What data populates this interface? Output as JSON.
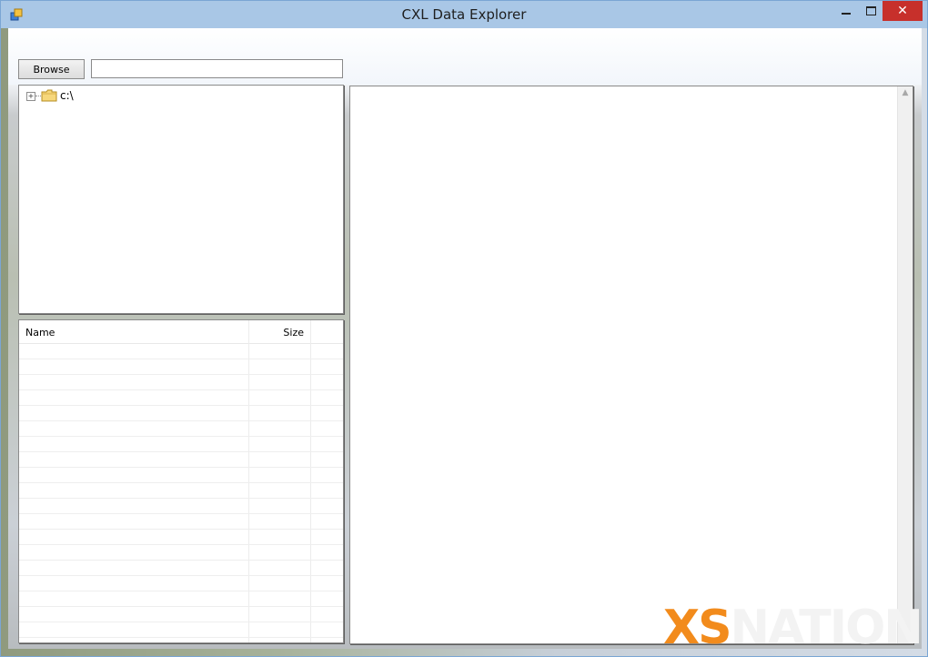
{
  "window": {
    "title": "CXL Data Explorer",
    "controls": {
      "minimize": "minimize",
      "maximize": "maximize",
      "close": "✕"
    }
  },
  "toolbar": {
    "browse_label": "Browse",
    "path_value": ""
  },
  "tree": {
    "nodes": [
      {
        "label": "c:\\",
        "expander": "+",
        "icon": "folder-icon"
      }
    ]
  },
  "file_list": {
    "columns": [
      "Name",
      "Size"
    ],
    "rows": []
  },
  "viewer": {
    "scroll_up": "▲"
  },
  "watermark": {
    "part1": "XS",
    "part2": "NATION"
  },
  "colors": {
    "titlebar": "#a9c7e6",
    "close_button": "#c7302b",
    "watermark_accent": "#f28b1c"
  }
}
